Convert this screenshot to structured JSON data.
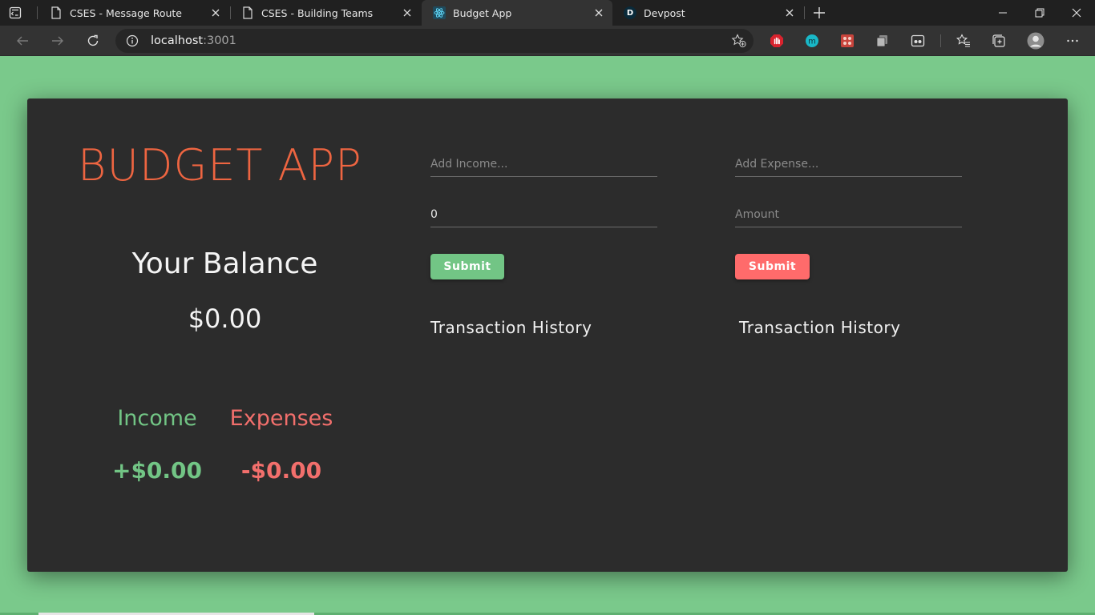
{
  "browser": {
    "tabs": [
      {
        "title": "CSES - Message Route",
        "active": false
      },
      {
        "title": "CSES - Building Teams",
        "active": false
      },
      {
        "title": "Budget App",
        "active": true
      },
      {
        "title": "Devpost",
        "active": false
      }
    ],
    "devpost_favicon_letter": "D",
    "url_host": "localhost",
    "url_port": ":3001"
  },
  "app": {
    "title": "BUDGET APP",
    "balance_label": "Your Balance",
    "balance_value": "$0.00",
    "income_label": "Income",
    "income_value": "+$0.00",
    "expenses_label": "Expenses",
    "expenses_value": "-$0.00",
    "income_form": {
      "name_placeholder": "Add Income...",
      "amount_value": "0",
      "submit_label": "Submit",
      "history_title": "Transaction History"
    },
    "expense_form": {
      "name_placeholder": "Add Expense...",
      "amount_placeholder": "Amount",
      "submit_label": "Submit",
      "history_title": "Transaction History"
    }
  },
  "colors": {
    "page_background": "#7ac98b",
    "card_background": "#2c2c2c",
    "title_orange": "#ee6541",
    "income_green": "#72c585",
    "expense_red": "#f26f6c",
    "expense_button_red": "#ff6b6b"
  }
}
